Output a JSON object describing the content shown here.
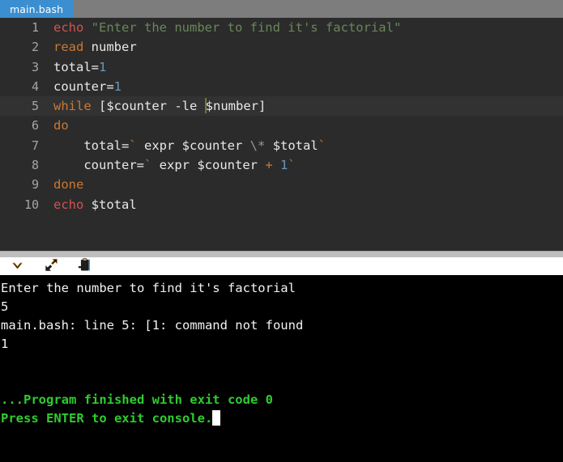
{
  "window": {
    "tab_label": "main.bash"
  },
  "editor": {
    "active_line": 5,
    "lines": [
      {
        "num": "1",
        "tokens": [
          {
            "c": "t-echo",
            "t": "echo"
          },
          {
            "c": "t-plain",
            "t": " "
          },
          {
            "c": "t-str",
            "t": "\"Enter the number to find it's factorial\""
          }
        ]
      },
      {
        "num": "2",
        "tokens": [
          {
            "c": "t-kw",
            "t": "read"
          },
          {
            "c": "t-plain",
            "t": " "
          },
          {
            "c": "t-plain",
            "t": "number"
          }
        ]
      },
      {
        "num": "3",
        "tokens": [
          {
            "c": "t-plain",
            "t": "total="
          },
          {
            "c": "t-num",
            "t": "1"
          }
        ]
      },
      {
        "num": "4",
        "tokens": [
          {
            "c": "t-plain",
            "t": "counter="
          },
          {
            "c": "t-num",
            "t": "1"
          }
        ]
      },
      {
        "num": "5",
        "tokens": [
          {
            "c": "t-kw",
            "t": "while"
          },
          {
            "c": "t-plain",
            "t": " ["
          },
          {
            "c": "t-var",
            "t": "$counter"
          },
          {
            "c": "t-plain",
            "t": " -le "
          },
          {
            "c": "caret",
            "t": ""
          },
          {
            "c": "t-var",
            "t": "$number"
          },
          {
            "c": "t-plain",
            "t": "]"
          }
        ]
      },
      {
        "num": "6",
        "tokens": [
          {
            "c": "t-kw",
            "t": "do"
          }
        ]
      },
      {
        "num": "7",
        "tokens": [
          {
            "c": "t-plain",
            "t": "    total="
          },
          {
            "c": "t-tick",
            "t": "`"
          },
          {
            "c": "t-plain",
            "t": " expr "
          },
          {
            "c": "t-var",
            "t": "$counter"
          },
          {
            "c": "t-plain",
            "t": " "
          },
          {
            "c": "t-op",
            "t": "\\*"
          },
          {
            "c": "t-plain",
            "t": " "
          },
          {
            "c": "t-var",
            "t": "$total"
          },
          {
            "c": "t-tick",
            "t": "`"
          }
        ]
      },
      {
        "num": "8",
        "tokens": [
          {
            "c": "t-plain",
            "t": "    counter="
          },
          {
            "c": "t-tick",
            "t": "`"
          },
          {
            "c": "t-plain",
            "t": " expr "
          },
          {
            "c": "t-var",
            "t": "$counter"
          },
          {
            "c": "t-plain",
            "t": " "
          },
          {
            "c": "t-kw",
            "t": "+"
          },
          {
            "c": "t-plain",
            "t": " "
          },
          {
            "c": "t-num",
            "t": "1"
          },
          {
            "c": "t-tick",
            "t": "`"
          }
        ]
      },
      {
        "num": "9",
        "tokens": [
          {
            "c": "t-kw",
            "t": "done"
          }
        ]
      },
      {
        "num": "10",
        "tokens": [
          {
            "c": "t-echo",
            "t": "echo"
          },
          {
            "c": "t-plain",
            "t": " "
          },
          {
            "c": "t-var",
            "t": "$total"
          }
        ]
      }
    ]
  },
  "toolbar": {
    "buttons": [
      {
        "icon": "chevron-down-icon",
        "name": "collapse-console-button"
      },
      {
        "icon": "expand-arrows-icon",
        "name": "maximize-console-button"
      },
      {
        "icon": "clipboard-paste-icon",
        "name": "copy-console-button"
      }
    ]
  },
  "console": {
    "lines": [
      {
        "style": "c-white",
        "text": "Enter the number to find it's factorial",
        "cursor": false
      },
      {
        "style": "c-white",
        "text": "5",
        "cursor": false
      },
      {
        "style": "c-white",
        "text": "main.bash: line 5: [1: command not found",
        "cursor": false
      },
      {
        "style": "c-white",
        "text": "1",
        "cursor": false
      },
      {
        "style": "c-white",
        "text": "",
        "cursor": false
      },
      {
        "style": "c-white",
        "text": "",
        "cursor": false
      },
      {
        "style": "c-green",
        "text": "...Program finished with exit code 0",
        "cursor": false
      },
      {
        "style": "c-green",
        "text": "Press ENTER to exit console.",
        "cursor": true
      }
    ]
  },
  "colors": {
    "tab_active": "#3b8fd1",
    "tabbar_bg": "#7d7d7d",
    "editor_bg": "#2b2b2b",
    "editor_active_line": "#323232",
    "console_bg": "#000000",
    "console_success": "#2ecc2e",
    "splitter": "#bebebe"
  }
}
